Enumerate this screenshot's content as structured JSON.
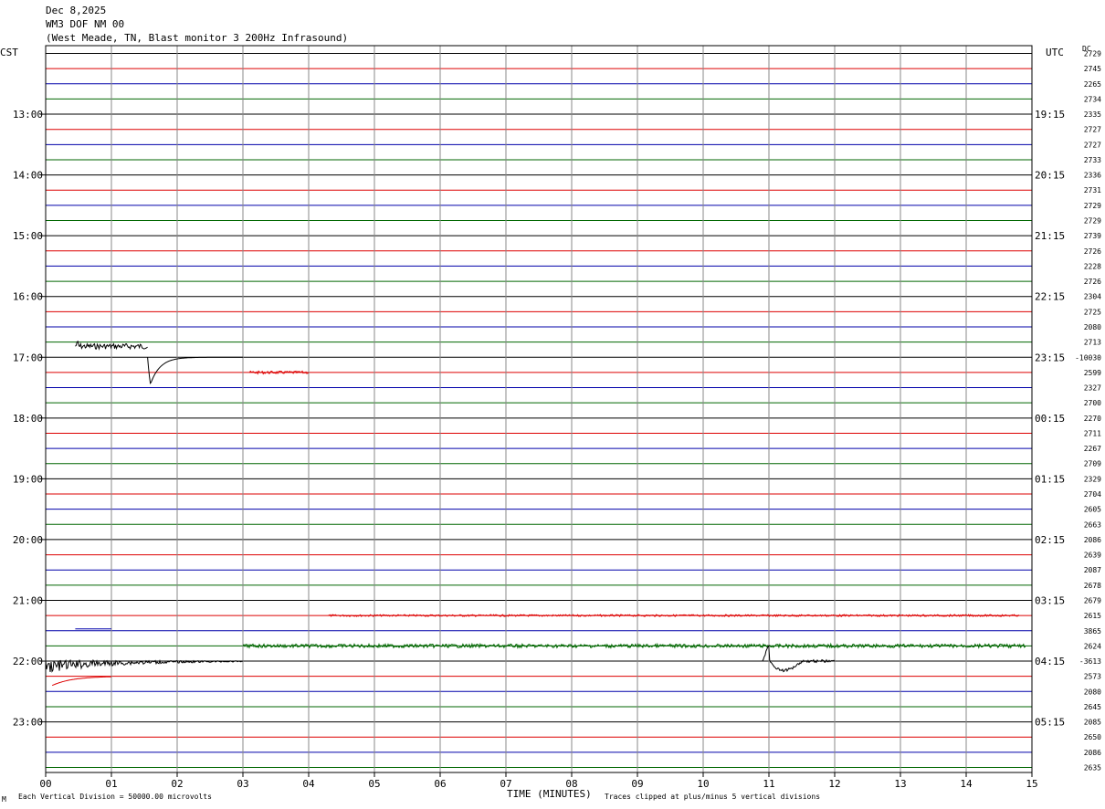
{
  "header": {
    "date": "Dec 8,2025",
    "station": "WM3 DOF NM 00",
    "description": "(West Meade, TN, Blast monitor 3 200Hz Infrasound)"
  },
  "labels": {
    "left_zone": "CST",
    "right_zone": "UTC",
    "dc_header": "DC",
    "footer_left": "Each Vertical Division = 50000.00 microvolts",
    "footer_center": "TIME (MINUTES)",
    "footer_right": "Traces clipped at plus/minus 5 vertical divisions",
    "corner_mark": "M"
  },
  "colors": {
    "trace_cycle": [
      "#000000",
      "#dd0000",
      "#0000aa",
      "#006600"
    ],
    "grid_vertical": "#888888"
  },
  "chart_data": {
    "type": "line",
    "title": "WM3 DOF NM 00",
    "xlabel": "TIME (MINUTES)",
    "xlim": [
      0,
      15
    ],
    "x_ticks": [
      "00",
      "01",
      "02",
      "03",
      "04",
      "05",
      "06",
      "07",
      "08",
      "09",
      "10",
      "11",
      "12",
      "13",
      "14",
      "15"
    ],
    "rows_per_hour": 4,
    "row_count": 48,
    "cst_hour_labels": [
      "13:00",
      "14:00",
      "15:00",
      "16:00",
      "17:00",
      "18:00",
      "19:00",
      "20:00",
      "21:00",
      "22:00",
      "23:00"
    ],
    "utc_hour_labels": [
      "19:15",
      "20:15",
      "21:15",
      "22:15",
      "23:15",
      "00:15",
      "01:15",
      "02:15",
      "03:15",
      "04:15",
      "05:15"
    ],
    "dc_offsets": [
      "2729",
      "2745",
      "2265",
      "2734",
      "2335",
      "2727",
      "2727",
      "2733",
      "2336",
      "2731",
      "2729",
      "2729",
      "2739",
      "2726",
      "2228",
      "2726",
      "2304",
      "2725",
      "2080",
      "2713",
      "-10030",
      "2599",
      "2327",
      "2700",
      "2270",
      "2711",
      "2267",
      "2709",
      "2329",
      "2704",
      "2605",
      "2663",
      "2086",
      "2639",
      "2087",
      "2678",
      "2679",
      "2615",
      "3865",
      "2624",
      "-3613",
      "2573",
      "2080",
      "2645",
      "2085",
      "2650",
      "2086",
      "2635"
    ],
    "vertical_division_microvolts": 50000,
    "clip_divisions": 5,
    "events": [
      {
        "row": 20,
        "start": 0.45,
        "end": 1.55,
        "kind": "burst",
        "amp": -12
      },
      {
        "row": 20,
        "start": 1.55,
        "end": 3.0,
        "kind": "spike_decay",
        "amp": 40
      },
      {
        "row": 21,
        "start": 3.1,
        "end": 4.0,
        "kind": "noise",
        "amp": 1.5
      },
      {
        "row": 37,
        "start": 4.3,
        "end": 14.8,
        "kind": "noise",
        "amp": 1.0
      },
      {
        "row": 39,
        "start": 3.0,
        "end": 14.9,
        "kind": "noise",
        "amp": 2.0
      },
      {
        "row": 40,
        "start": 0.0,
        "end": 3.0,
        "kind": "burst_decay",
        "amp": 14
      },
      {
        "row": 40,
        "start": 10.9,
        "end": 12.0,
        "kind": "dip",
        "amp": 14
      },
      {
        "row": 41,
        "start": 0.1,
        "end": 1.0,
        "kind": "step",
        "amp": -6
      },
      {
        "row": 38,
        "start": 0.45,
        "end": 1.0,
        "kind": "flat",
        "amp": 0
      }
    ]
  }
}
